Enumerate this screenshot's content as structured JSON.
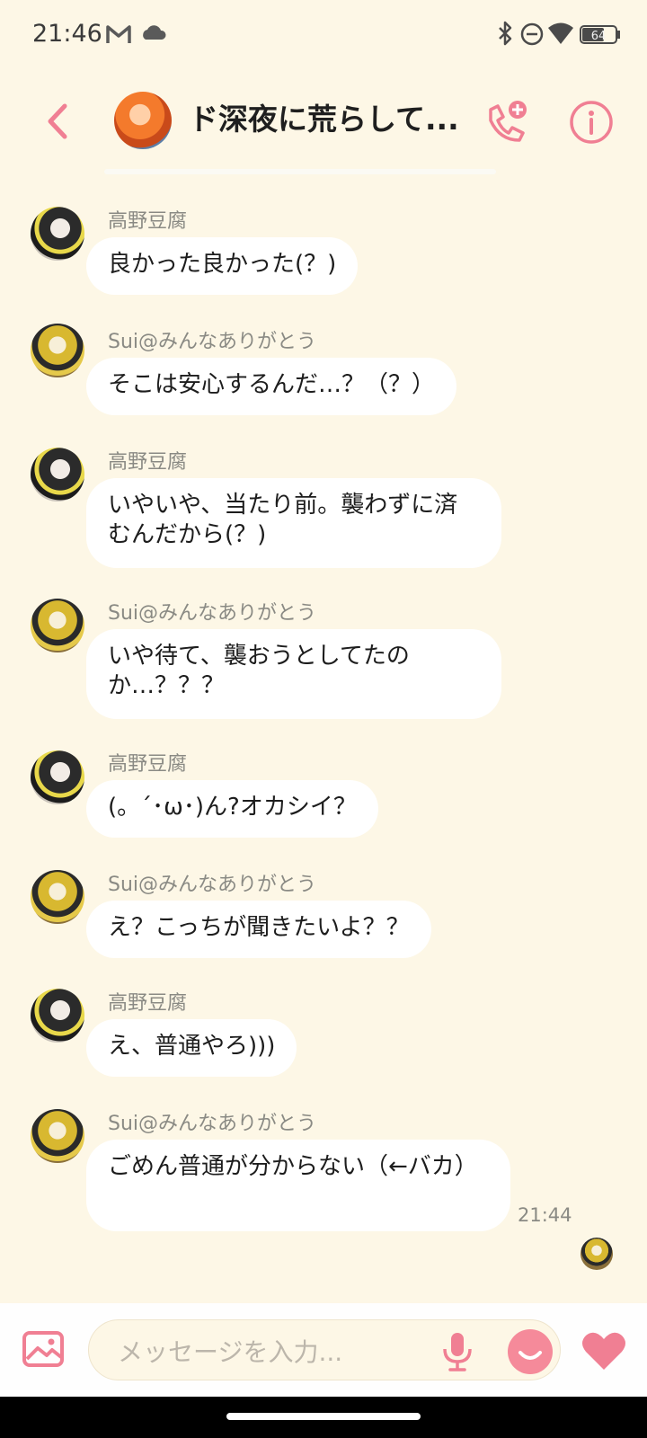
{
  "status_bar": {
    "time": "21:46",
    "battery": "64"
  },
  "header": {
    "title": "ド深夜に荒らして..."
  },
  "messages": [
    {
      "sender": "高野豆腐",
      "text": "良かった良かった(？)"
    },
    {
      "sender": "Sui@みんなありがとう",
      "text": "そこは安心するんだ…？（？）"
    },
    {
      "sender": "高野豆腐",
      "text": "いやいや、当たり前。襲わずに済むんだから(？)"
    },
    {
      "sender": "Sui@みんなありがとう",
      "text": "いや待て、襲おうとしてたのか…？？？"
    },
    {
      "sender": "高野豆腐",
      "text": "(。´･ω･)ん?オカシイ？"
    },
    {
      "sender": "Sui@みんなありがとう",
      "text": "え？こっちが聞きたいよ？？"
    },
    {
      "sender": "高野豆腐",
      "text": "え、普通やろ)))"
    },
    {
      "sender": "Sui@みんなありがとう",
      "text": "ごめん普通が分からない（←バカ）",
      "time": "21:44"
    }
  ],
  "composer": {
    "placeholder": "メッセージを入力..."
  },
  "colors": {
    "accent": "#f07f93",
    "background": "#fdf7e6",
    "bubble": "#ffffff"
  },
  "icons": [
    "gmail-icon",
    "cloud-icon",
    "bluetooth-icon",
    "dnd-icon",
    "wifi-icon",
    "battery-icon",
    "back-icon",
    "add-call-icon",
    "info-icon",
    "image-icon",
    "mic-icon",
    "sticker-icon",
    "heart-icon"
  ]
}
